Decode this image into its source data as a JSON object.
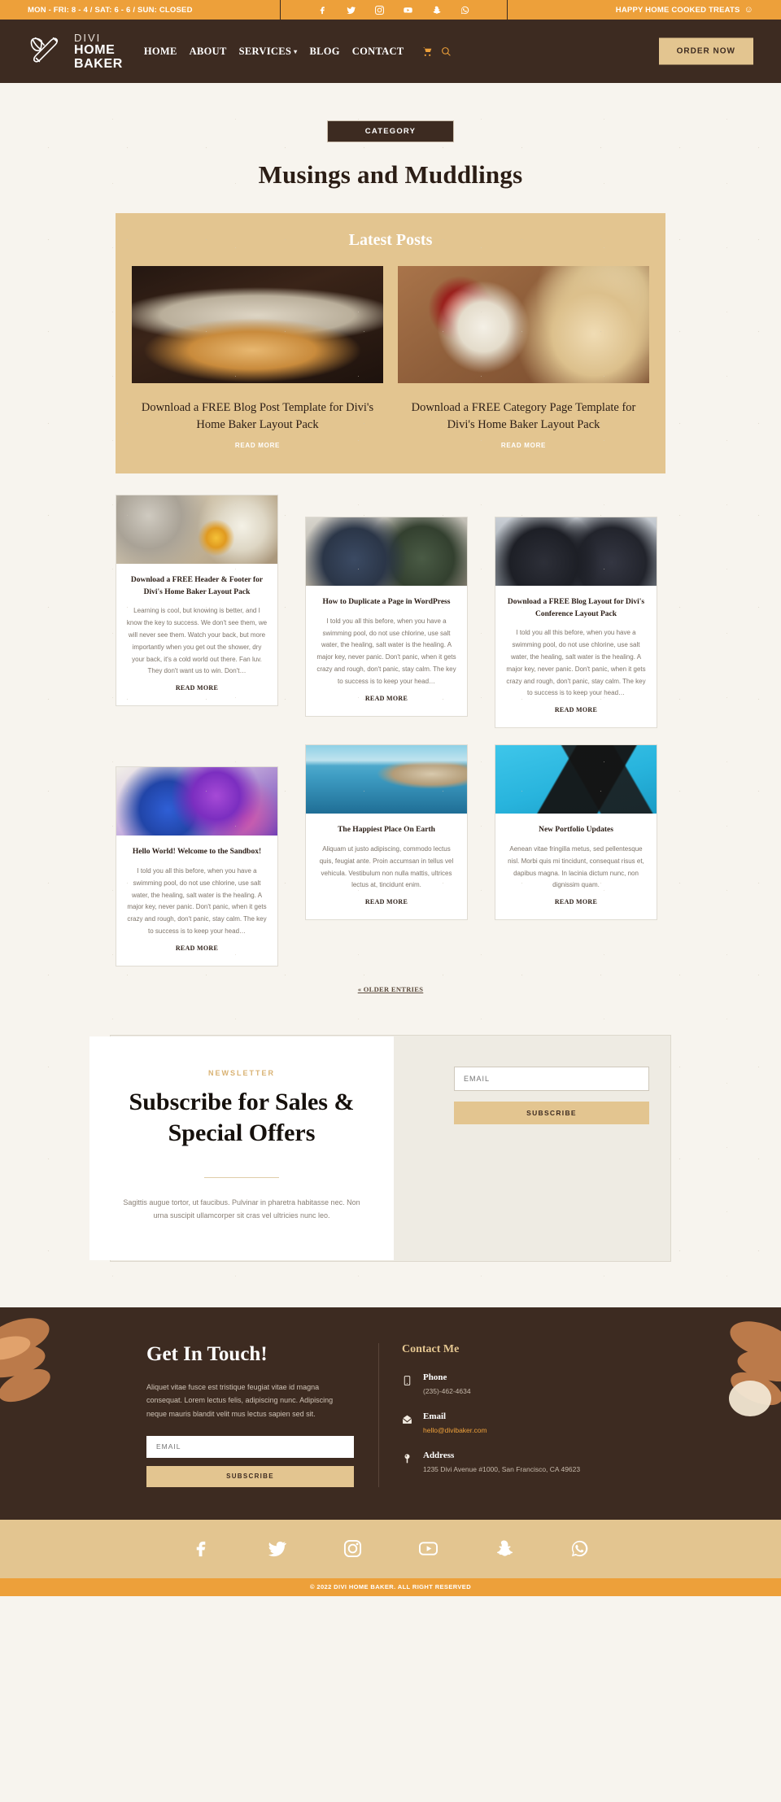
{
  "topbar": {
    "hours": "MON - FRI: 8 - 4 / SAT: 6 - 6 / SUN: CLOSED",
    "tagline": "HAPPY HOME COOKED TREATS",
    "tagline_emoji": "☺",
    "socials": [
      "facebook-icon",
      "twitter-icon",
      "instagram-icon",
      "youtube-icon",
      "snapchat-icon",
      "whatsapp-icon"
    ]
  },
  "header": {
    "logo_line1": "DIVI",
    "logo_line2": "HOME",
    "logo_line3": "BAKER",
    "nav": [
      {
        "label": "HOME",
        "has_caret": false
      },
      {
        "label": "ABOUT",
        "has_caret": false
      },
      {
        "label": "SERVICES",
        "has_caret": true
      },
      {
        "label": "BLOG",
        "has_caret": false
      },
      {
        "label": "CONTACT",
        "has_caret": false
      }
    ],
    "cart_icon": "cart-icon",
    "search_icon": "search-icon",
    "order_button": "ORDER NOW"
  },
  "hero": {
    "badge": "CATEGORY",
    "title": "Musings and Muddlings"
  },
  "latest": {
    "heading": "Latest Posts",
    "posts": [
      {
        "title": "Download a FREE Blog Post Template for Divi's Home Baker Layout Pack",
        "read_more": "READ MORE",
        "image": "bread-loaf-photo"
      },
      {
        "title": "Download a FREE Category Page Template for Divi's Home Baker Layout Pack",
        "read_more": "READ MORE",
        "image": "strawberry-cheesecake-photo"
      }
    ]
  },
  "grid": {
    "read_more": "READ MORE",
    "row1": [
      {
        "image": "eggs-whisk-photo",
        "title": "Download a FREE Header & Footer for Divi's Home Baker Layout Pack",
        "excerpt": "Learning is cool, but knowing is better, and I know the key to success. We don't see them, we will never see them. Watch your back, but more importantly when you get out the shower, dry your back, it's a cold world out there. Fan luv. They don't want us to win. Don't…"
      },
      {
        "image": "meeting-cafe-photo",
        "title": "How to Duplicate a Page in WordPress",
        "excerpt": "I told you all this before, when you have a swimming pool, do not use chlorine, use salt water, the healing, salt water is the healing. A major key, never panic. Don't panic, when it gets crazy and rough, don't panic, stay calm. The key to success is to keep your head…"
      },
      {
        "image": "businessmen-photo",
        "title": "Download a FREE Blog Layout for Divi's Conference Layout Pack",
        "excerpt": "I told you all this before, when you have a swimming pool, do not use chlorine, use salt water, the healing, salt water is the healing. A major key, never panic. Don't panic, when it gets crazy and rough, don't panic, stay calm. The key to success is to keep your head…"
      }
    ],
    "row2": [
      {
        "image": "purple-ink-photo",
        "title": "Hello World! Welcome to the Sandbox!",
        "excerpt": "I told you all this before, when you have a swimming pool, do not use chlorine, use salt water, the healing, salt water is the healing. A major key, never panic. Don't panic, when it gets crazy and rough, don't panic, stay calm. The key to success is to keep your head…"
      },
      {
        "image": "coastal-sea-photo",
        "title": "The Happiest Place On Earth",
        "excerpt": "Aliquam ut justo adipiscing, commodo lectus quis, feugiat ante. Proin accumsan in tellus vel vehicula. Vestibulum non nulla mattis, ultrices lectus at, tincidunt enim."
      },
      {
        "image": "black-cards-photo",
        "title": "New Portfolio Updates",
        "excerpt": "Aenean vitae fringilla metus, sed pellentesque nisl. Morbi quis mi tincidunt, consequat risus et, dapibus magna. In lacinia dictum nunc, non dignissim quam."
      }
    ],
    "older_entries": "« OLDER ENTRIES"
  },
  "newsletter": {
    "kicker": "NEWSLETTER",
    "title": "Subscribe for Sales & Special Offers",
    "body": "Sagittis augue tortor, ut faucibus. Pulvinar in pharetra habitasse nec. Non urna suscipit ullamcorper sit cras vel ultricies nunc leo.",
    "email_placeholder": "EMAIL",
    "subscribe_label": "SUBSCRIBE"
  },
  "footer": {
    "heading": "Get In Touch!",
    "body": "Aliquet vitae fusce est tristique feugiat vitae id magna consequat. Lorem lectus felis, adipiscing nunc. Adipiscing neque mauris blandit velit mus lectus sapien sed sit.",
    "email_placeholder": "EMAIL",
    "subscribe_label": "SUBSCRIBE",
    "contact_heading": "Contact Me",
    "contacts": [
      {
        "icon": "phone-icon",
        "label": "Phone",
        "value": "(235)-462-4634",
        "is_link": false
      },
      {
        "icon": "envelope-icon",
        "label": "Email",
        "value": "hello@divibaker.com",
        "is_link": true
      },
      {
        "icon": "map-pin-icon",
        "label": "Address",
        "value": "1235 Divi Avenue #1000, San Francisco, CA 49623",
        "is_link": false
      }
    ],
    "socials": [
      "facebook-icon",
      "twitter-icon",
      "instagram-icon",
      "youtube-icon",
      "snapchat-icon",
      "whatsapp-icon"
    ],
    "copyright": "© 2022 DIVI HOME BAKER. ALL RIGHT RESERVED"
  },
  "colors": {
    "accent_orange": "#eda03a",
    "brand_dark": "#3d2b21",
    "tan": "#e3c590",
    "page_bg": "#f7f4ee"
  }
}
